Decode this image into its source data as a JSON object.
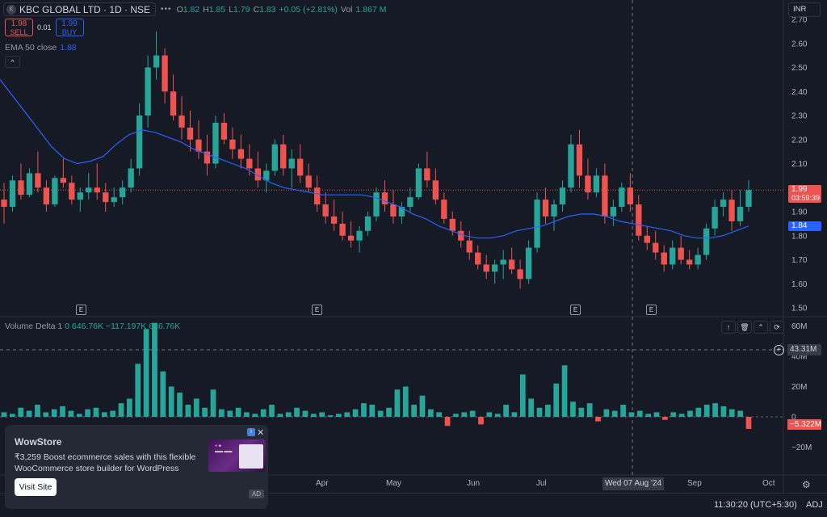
{
  "header": {
    "symbol_title": "KBC GLOBAL LTD · 1D · NSE",
    "logo_letter": "K",
    "more": "•••",
    "ohlc": [
      {
        "k": "O",
        "v": "1.82"
      },
      {
        "k": "H",
        "v": "1.85"
      },
      {
        "k": "L",
        "v": "1.79"
      },
      {
        "k": "C",
        "v": "1.83"
      }
    ],
    "change": "+0.05 (+2.81%)",
    "vol_label": "Vol",
    "vol_value": "1.867 M"
  },
  "trade": {
    "sell_price": "1.98",
    "sell_label": "SELL",
    "spread": "0.01",
    "buy_price": "1.99",
    "buy_label": "BUY"
  },
  "ema": {
    "label": "EMA 50 close",
    "value": "1.88"
  },
  "currency": "INR",
  "price_axis": {
    "ticks": [
      "2.70",
      "2.60",
      "2.50",
      "2.40",
      "2.30",
      "2.20",
      "2.10",
      "2.00",
      "1.90",
      "1.80",
      "1.70",
      "1.60",
      "1.50"
    ]
  },
  "last_price": {
    "price": "1.99",
    "countdown": "03:59:39"
  },
  "ema_tag": "1.84",
  "volume_delta": {
    "title": "Volume Delta",
    "param": "1",
    "values": "0  646.76K  −117.197K  646.76K",
    "axis_ticks": [
      "60M",
      "40M",
      "20M",
      "0",
      "−20M"
    ],
    "crosshair_value": "43.31M",
    "last_value": "−5.322M"
  },
  "time_axis": {
    "labels": [
      "Apr",
      "May",
      "Jun",
      "Jul",
      "Sep",
      "Oct"
    ],
    "crosshair_date": "Wed 07 Aug '24"
  },
  "earnings_marker": "E",
  "bottom": {
    "clock": "11:30:20 (UTC+5:30)",
    "adj": "ADJ"
  },
  "ad": {
    "title": "WowStore",
    "description": "₹3,259 Boost ecommerce sales with this flexible WooCommerce store builder for WordPress",
    "button": "Visit Site",
    "badge": "AD",
    "close": "✕"
  },
  "colors": {
    "up": "#26a69a",
    "down": "#ef5350",
    "ema": "#2962ff",
    "bg": "#161a25"
  },
  "chart_data": {
    "type": "candlestick",
    "ylim": [
      1.5,
      2.7
    ],
    "ema_period": 50,
    "candles": [
      [
        1.95,
        2.02,
        1.85,
        1.92
      ],
      [
        1.92,
        2.05,
        1.9,
        2.03
      ],
      [
        2.03,
        2.1,
        1.95,
        1.97
      ],
      [
        1.97,
        2.08,
        1.96,
        2.06
      ],
      [
        2.06,
        2.15,
        1.98,
        2.0
      ],
      [
        2.0,
        2.03,
        1.9,
        1.93
      ],
      [
        1.93,
        2.05,
        1.92,
        2.04
      ],
      [
        2.04,
        2.12,
        2.0,
        2.02
      ],
      [
        2.02,
        2.05,
        1.93,
        1.95
      ],
      [
        1.95,
        2.0,
        1.9,
        1.98
      ],
      [
        1.98,
        2.06,
        1.95,
        2.0
      ],
      [
        2.0,
        2.1,
        1.95,
        1.98
      ],
      [
        1.98,
        2.02,
        1.9,
        1.94
      ],
      [
        1.94,
        2.0,
        1.92,
        1.96
      ],
      [
        1.96,
        2.03,
        1.93,
        2.0
      ],
      [
        2.0,
        2.12,
        1.98,
        2.08
      ],
      [
        2.08,
        2.35,
        2.05,
        2.3
      ],
      [
        2.3,
        2.55,
        2.25,
        2.5
      ],
      [
        2.5,
        2.65,
        2.45,
        2.55
      ],
      [
        2.55,
        2.58,
        2.35,
        2.4
      ],
      [
        2.4,
        2.47,
        2.28,
        2.3
      ],
      [
        2.3,
        2.38,
        2.2,
        2.25
      ],
      [
        2.25,
        2.32,
        2.15,
        2.2
      ],
      [
        2.2,
        2.28,
        2.12,
        2.15
      ],
      [
        2.15,
        2.22,
        2.05,
        2.1
      ],
      [
        2.1,
        2.3,
        2.08,
        2.27
      ],
      [
        2.27,
        2.31,
        2.18,
        2.2
      ],
      [
        2.2,
        2.25,
        2.12,
        2.16
      ],
      [
        2.16,
        2.22,
        2.08,
        2.12
      ],
      [
        2.12,
        2.18,
        2.05,
        2.08
      ],
      [
        2.08,
        2.15,
        2.0,
        2.03
      ],
      [
        2.03,
        2.1,
        1.98,
        2.07
      ],
      [
        2.07,
        2.2,
        2.05,
        2.18
      ],
      [
        2.18,
        2.22,
        2.05,
        2.08
      ],
      [
        2.08,
        2.16,
        2.0,
        2.12
      ],
      [
        2.12,
        2.18,
        2.02,
        2.05
      ],
      [
        2.05,
        2.1,
        1.98,
        2.0
      ],
      [
        2.0,
        2.05,
        1.9,
        1.93
      ],
      [
        1.93,
        1.98,
        1.85,
        1.88
      ],
      [
        1.88,
        1.95,
        1.82,
        1.85
      ],
      [
        1.85,
        1.9,
        1.78,
        1.8
      ],
      [
        1.8,
        1.86,
        1.75,
        1.78
      ],
      [
        1.78,
        1.84,
        1.73,
        1.82
      ],
      [
        1.82,
        1.9,
        1.8,
        1.88
      ],
      [
        1.88,
        2.0,
        1.86,
        1.98
      ],
      [
        1.98,
        2.03,
        1.9,
        1.93
      ],
      [
        1.93,
        1.99,
        1.85,
        1.88
      ],
      [
        1.88,
        1.94,
        1.85,
        1.92
      ],
      [
        1.92,
        2.0,
        1.9,
        1.96
      ],
      [
        1.96,
        2.1,
        1.95,
        2.08
      ],
      [
        2.08,
        2.15,
        2.0,
        2.03
      ],
      [
        2.03,
        2.08,
        1.93,
        1.95
      ],
      [
        1.95,
        1.98,
        1.85,
        1.87
      ],
      [
        1.87,
        1.9,
        1.8,
        1.82
      ],
      [
        1.82,
        1.86,
        1.75,
        1.78
      ],
      [
        1.78,
        1.82,
        1.7,
        1.73
      ],
      [
        1.73,
        1.76,
        1.66,
        1.68
      ],
      [
        1.68,
        1.72,
        1.62,
        1.65
      ],
      [
        1.65,
        1.7,
        1.6,
        1.68
      ],
      [
        1.68,
        1.74,
        1.62,
        1.7
      ],
      [
        1.7,
        1.75,
        1.64,
        1.66
      ],
      [
        1.66,
        1.7,
        1.58,
        1.62
      ],
      [
        1.62,
        1.78,
        1.6,
        1.75
      ],
      [
        1.75,
        1.98,
        1.73,
        1.95
      ],
      [
        1.95,
        2.0,
        1.85,
        1.88
      ],
      [
        1.88,
        1.95,
        1.82,
        1.93
      ],
      [
        1.93,
        2.03,
        1.9,
        2.0
      ],
      [
        2.0,
        2.22,
        1.98,
        2.18
      ],
      [
        2.18,
        2.24,
        2.0,
        2.05
      ],
      [
        2.05,
        2.12,
        1.95,
        1.98
      ],
      [
        1.98,
        2.08,
        1.96,
        2.05
      ],
      [
        2.05,
        2.1,
        1.85,
        1.88
      ],
      [
        1.88,
        1.95,
        1.84,
        1.92
      ],
      [
        1.92,
        2.02,
        1.9,
        2.0
      ],
      [
        2.0,
        2.06,
        1.9,
        1.93
      ],
      [
        1.93,
        1.97,
        1.78,
        1.8
      ],
      [
        1.8,
        1.84,
        1.74,
        1.77
      ],
      [
        1.77,
        1.82,
        1.7,
        1.73
      ],
      [
        1.73,
        1.76,
        1.65,
        1.68
      ],
      [
        1.68,
        1.78,
        1.66,
        1.75
      ],
      [
        1.75,
        1.8,
        1.68,
        1.7
      ],
      [
        1.7,
        1.74,
        1.66,
        1.68
      ],
      [
        1.68,
        1.75,
        1.66,
        1.72
      ],
      [
        1.72,
        1.85,
        1.7,
        1.83
      ],
      [
        1.83,
        1.95,
        1.8,
        1.92
      ],
      [
        1.92,
        1.98,
        1.88,
        1.95
      ],
      [
        1.95,
        1.99,
        1.82,
        1.86
      ],
      [
        1.86,
        1.99,
        1.84,
        1.92
      ],
      [
        1.92,
        2.03,
        1.9,
        1.99
      ]
    ],
    "ema": [
      2.45,
      2.38,
      2.31,
      2.24,
      2.17,
      2.12,
      2.1,
      2.11,
      2.13,
      2.18,
      2.22,
      2.24,
      2.23,
      2.21,
      2.19,
      2.16,
      2.14,
      2.12,
      2.1,
      2.08,
      2.05,
      2.02,
      2.0,
      1.99,
      1.98,
      1.97,
      1.97,
      1.97,
      1.97,
      1.96,
      1.94,
      1.92,
      1.89,
      1.87,
      1.84,
      1.82,
      1.8,
      1.79,
      1.79,
      1.8,
      1.82,
      1.83,
      1.84,
      1.86,
      1.88,
      1.89,
      1.89,
      1.88,
      1.86,
      1.85,
      1.84,
      1.83,
      1.82,
      1.8,
      1.79,
      1.79,
      1.8,
      1.82,
      1.84
    ],
    "volume_delta": [
      3,
      2,
      6,
      4,
      8,
      3,
      5,
      7,
      4,
      2,
      5,
      6,
      3,
      4,
      9,
      12,
      35,
      58,
      62,
      30,
      20,
      16,
      8,
      12,
      6,
      18,
      5,
      4,
      6,
      3,
      2,
      5,
      8,
      2,
      3,
      6,
      4,
      2,
      3,
      1,
      2,
      3,
      5,
      9,
      8,
      4,
      6,
      18,
      20,
      8,
      14,
      5,
      3,
      -6,
      2,
      3,
      4,
      -5,
      3,
      2,
      8,
      3,
      28,
      12,
      6,
      8,
      22,
      34,
      10,
      6,
      9,
      -3,
      5,
      4,
      8,
      3,
      4,
      2,
      3,
      -2,
      3,
      2,
      4,
      6,
      8,
      9,
      7,
      5,
      4,
      -8
    ],
    "crosshair_x_label": "Wed 07 Aug '24"
  }
}
